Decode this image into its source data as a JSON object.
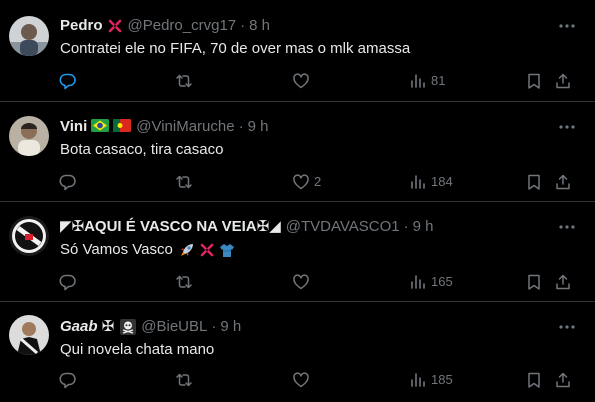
{
  "tweets": [
    {
      "name": "Pedro",
      "handle": "@Pedro_crvg17",
      "dot": "·",
      "time": "8 h",
      "text": "Contratei ele no FIFA, 70 de over mas o mlk amassa",
      "counts": {
        "reply": "",
        "retweet": "",
        "like": "",
        "views": "81"
      },
      "emojis_name": [
        "anger-emoji"
      ],
      "emojis_text": []
    },
    {
      "name": "Vini",
      "handle": "@ViniMaruche",
      "dot": "·",
      "time": "9 h",
      "text": "Bota casaco, tira casaco",
      "counts": {
        "reply": "",
        "retweet": "",
        "like": "2",
        "views": "184"
      },
      "emojis_name": [
        "flag-brazil",
        "flag-portugal"
      ],
      "emojis_text": []
    },
    {
      "name": "◤✠AQUI É VASCO NA VEIA✠◢",
      "handle": "@TVDAVASCO1",
      "dot": "·",
      "time": "9 h",
      "text": "Só Vamos Vasco",
      "counts": {
        "reply": "",
        "retweet": "",
        "like": "",
        "views": "165"
      },
      "emojis_name": [],
      "emojis_text": [
        "rocket-emoji",
        "anger-emoji",
        "shirt-emoji"
      ]
    },
    {
      "name": "Gaab ✠",
      "handle": "@BieUBL",
      "dot": "·",
      "time": "9 h",
      "text": "Qui novela chata mano",
      "counts": {
        "reply": "",
        "retweet": "",
        "like": "",
        "views": "185"
      },
      "emojis_name": [
        "skull-crossbones-emoji"
      ],
      "emojis_text": []
    }
  ],
  "colors": {
    "background": "#000000",
    "text": "#e7e9ea",
    "muted": "#71767b",
    "separator": "#2f3336"
  }
}
